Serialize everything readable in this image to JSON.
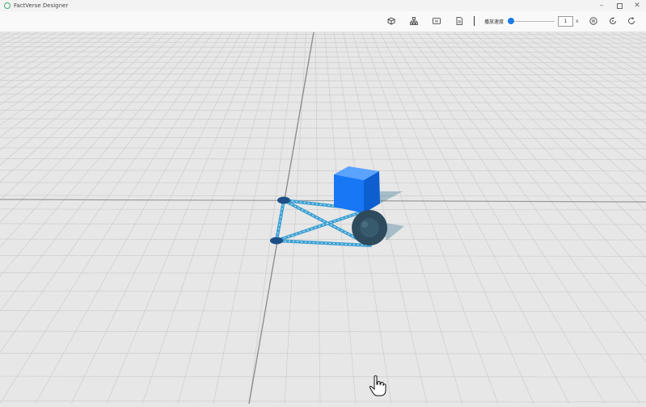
{
  "app": {
    "title": "FactVerse Designer"
  },
  "window": {
    "minimize_icon": "minimize-icon",
    "maximize_icon": "maximize-icon",
    "close_icon": "close-icon"
  },
  "toolbar": {
    "icons": [
      "cube-icon",
      "hierarchy-icon",
      "code-box-icon",
      "document-icon"
    ],
    "speed_label": "播放速度",
    "speed_value": "1",
    "speed_unit": "x",
    "controls": [
      "pause-icon",
      "replay-icon",
      "refresh-icon"
    ]
  },
  "scene": {
    "objects": [
      "box",
      "wheel",
      "frame",
      "left-joint",
      "bottom-joint"
    ],
    "colors": {
      "box": "#1777f5",
      "wheel": "#2d4b5c",
      "frame": "#3ea0d2",
      "grid": "#c9c9c9",
      "floor": "#e7e7e7"
    }
  }
}
